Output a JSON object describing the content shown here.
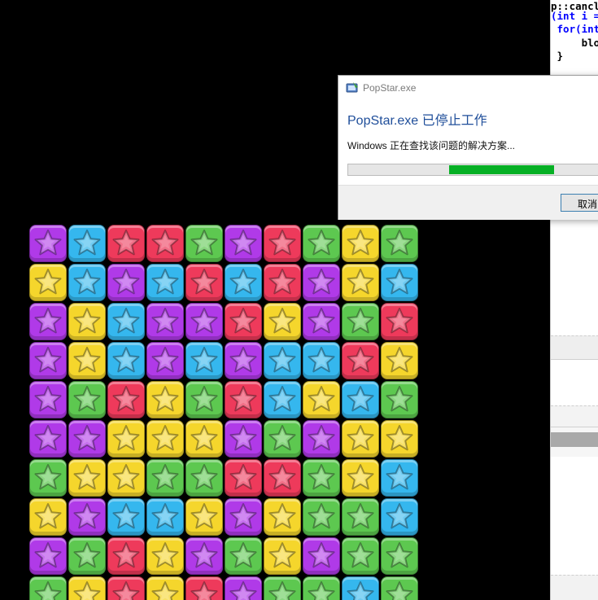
{
  "dialog": {
    "window_title": "PopStar.exe",
    "heading": "PopStar.exe 已停止工作",
    "message": "Windows 正在查找该问题的解决方案...",
    "progress_segment_start": 0.375,
    "progress_segment_end": 0.765,
    "cancel_label": "取消",
    "colors": {
      "heading": "#1f4e9a",
      "progress": "#06b025"
    }
  },
  "editor": {
    "lines": [
      {
        "text": "p::cancl",
        "kind": "plain"
      },
      {
        "text": "(int i =",
        "kind": "keyword"
      },
      {
        "text": " for(int",
        "kind": "keyword"
      },
      {
        "text": "     blo",
        "kind": "plain"
      },
      {
        "text": " }",
        "kind": "plain"
      }
    ]
  },
  "board": {
    "colors": {
      "P": "#b03ae8",
      "B": "#35b7ee",
      "R": "#ee3a5b",
      "G": "#5dc850",
      "Y": "#f5d62c"
    },
    "rows": [
      [
        "P",
        "B",
        "R",
        "R",
        "G",
        "P",
        "R",
        "G",
        "Y",
        "G"
      ],
      [
        "Y",
        "B",
        "P",
        "B",
        "R",
        "B",
        "R",
        "P",
        "Y",
        "B"
      ],
      [
        "P",
        "Y",
        "B",
        "P",
        "P",
        "R",
        "Y",
        "P",
        "G",
        "R"
      ],
      [
        "P",
        "Y",
        "B",
        "P",
        "B",
        "P",
        "B",
        "B",
        "R",
        "Y"
      ],
      [
        "P",
        "G",
        "R",
        "Y",
        "G",
        "R",
        "B",
        "Y",
        "B",
        "G"
      ],
      [
        "P",
        "P",
        "Y",
        "Y",
        "Y",
        "P",
        "G",
        "P",
        "Y",
        "Y"
      ],
      [
        "G",
        "Y",
        "Y",
        "G",
        "G",
        "R",
        "R",
        "G",
        "Y",
        "B"
      ],
      [
        "Y",
        "P",
        "B",
        "B",
        "Y",
        "P",
        "Y",
        "G",
        "G",
        "B"
      ],
      [
        "P",
        "G",
        "R",
        "Y",
        "P",
        "G",
        "Y",
        "P",
        "G",
        "G"
      ],
      [
        "G",
        "Y",
        "R",
        "Y",
        "R",
        "P",
        "G",
        "G",
        "B",
        "G"
      ]
    ]
  }
}
